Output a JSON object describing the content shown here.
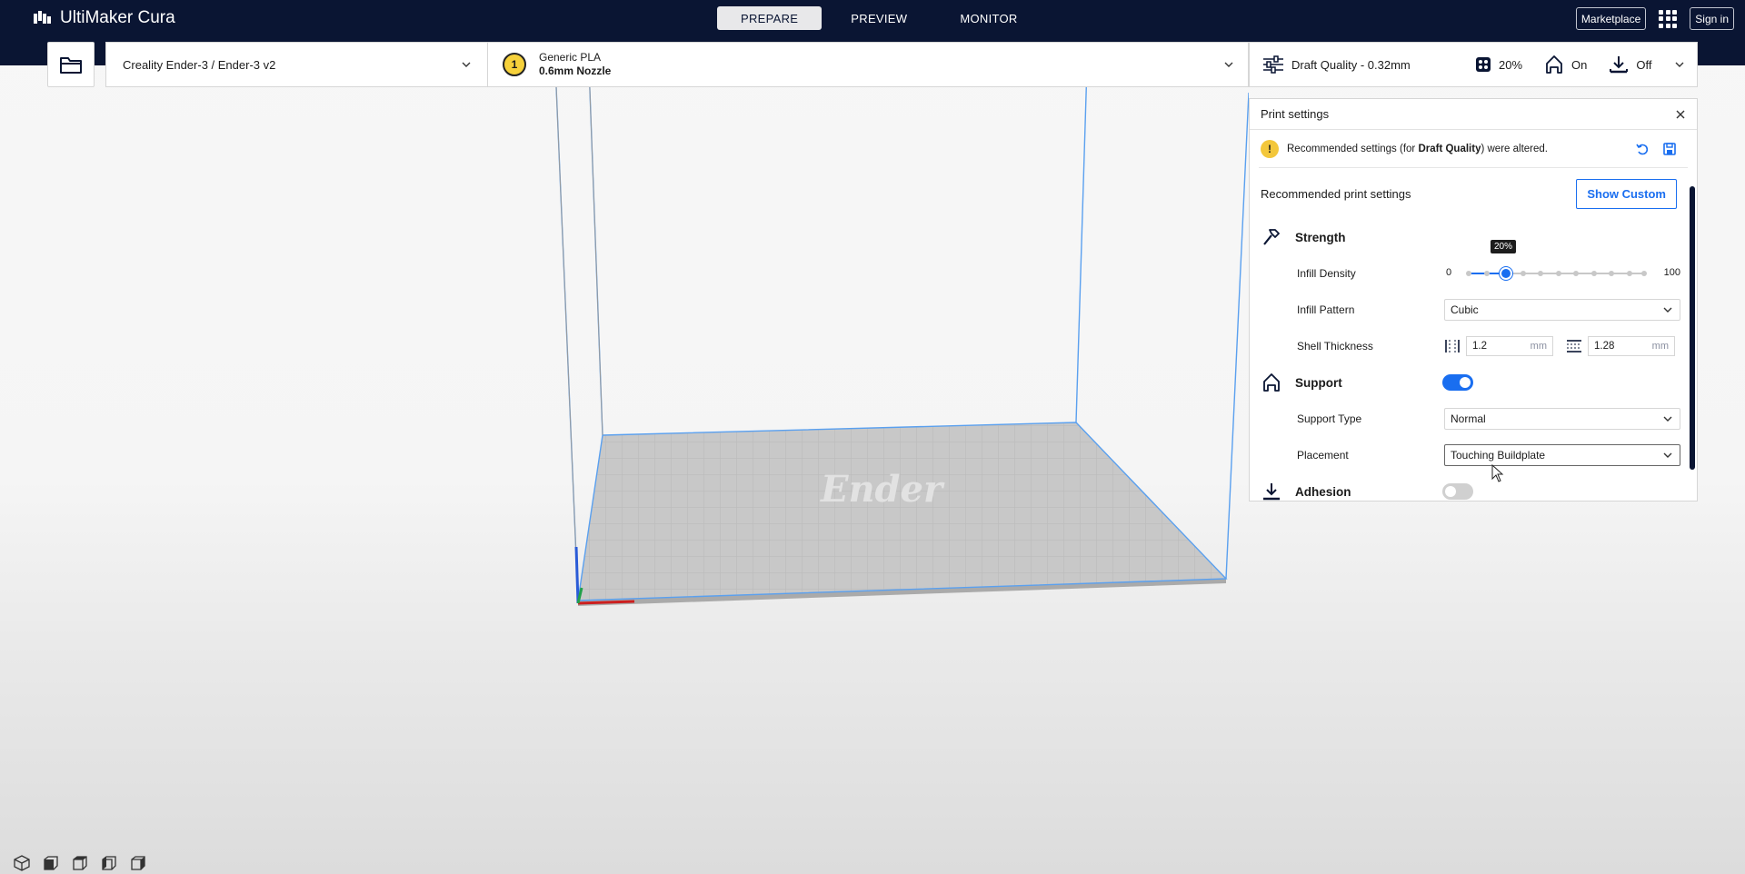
{
  "app": {
    "title": "UltiMaker Cura",
    "stages": [
      "PREPARE",
      "PREVIEW",
      "MONITOR"
    ],
    "active_stage": "PREPARE",
    "marketplace": "Marketplace",
    "sign_in": "Sign in"
  },
  "toolbar": {
    "open_icon": "folder-icon",
    "machine": "Creality Ender-3 / Ender-3 v2",
    "extruder_number": "1",
    "material": "Generic PLA",
    "nozzle": "0.6mm Nozzle",
    "quality": "Draft Quality - 0.32mm",
    "infill": "20%",
    "support": "On",
    "adhesion": "Off"
  },
  "panel": {
    "title": "Print settings",
    "alert_pre": "Recommended settings (for ",
    "alert_bold": "Draft Quality",
    "alert_post": ") were altered.",
    "recommended_heading": "Recommended print settings",
    "show_custom": "Show Custom",
    "strength": {
      "title": "Strength",
      "infill_density_label": "Infill Density",
      "slider_min": "0",
      "slider_max": "100",
      "slider_value": "20%",
      "infill_density_value": 20,
      "infill_pattern_label": "Infill Pattern",
      "infill_pattern": "Cubic",
      "shell_thickness_label": "Shell Thickness",
      "wall_thickness": "1.2",
      "top_bottom_thickness": "1.28",
      "unit": "mm"
    },
    "support": {
      "title": "Support",
      "enabled": true,
      "type_label": "Support Type",
      "type": "Normal",
      "placement_label": "Placement",
      "placement": "Touching Buildplate"
    },
    "adhesion": {
      "title": "Adhesion",
      "enabled": false
    }
  },
  "colors": {
    "header_bg": "#0a1533",
    "accent": "#196ef0",
    "warning": "#f3c73b",
    "build_plate": "#c8c8c8",
    "volume_edge": "#5aa0ef"
  },
  "views": [
    "3d-view-icon",
    "front-view-icon",
    "top-view-icon",
    "left-view-icon",
    "right-view-icon"
  ]
}
